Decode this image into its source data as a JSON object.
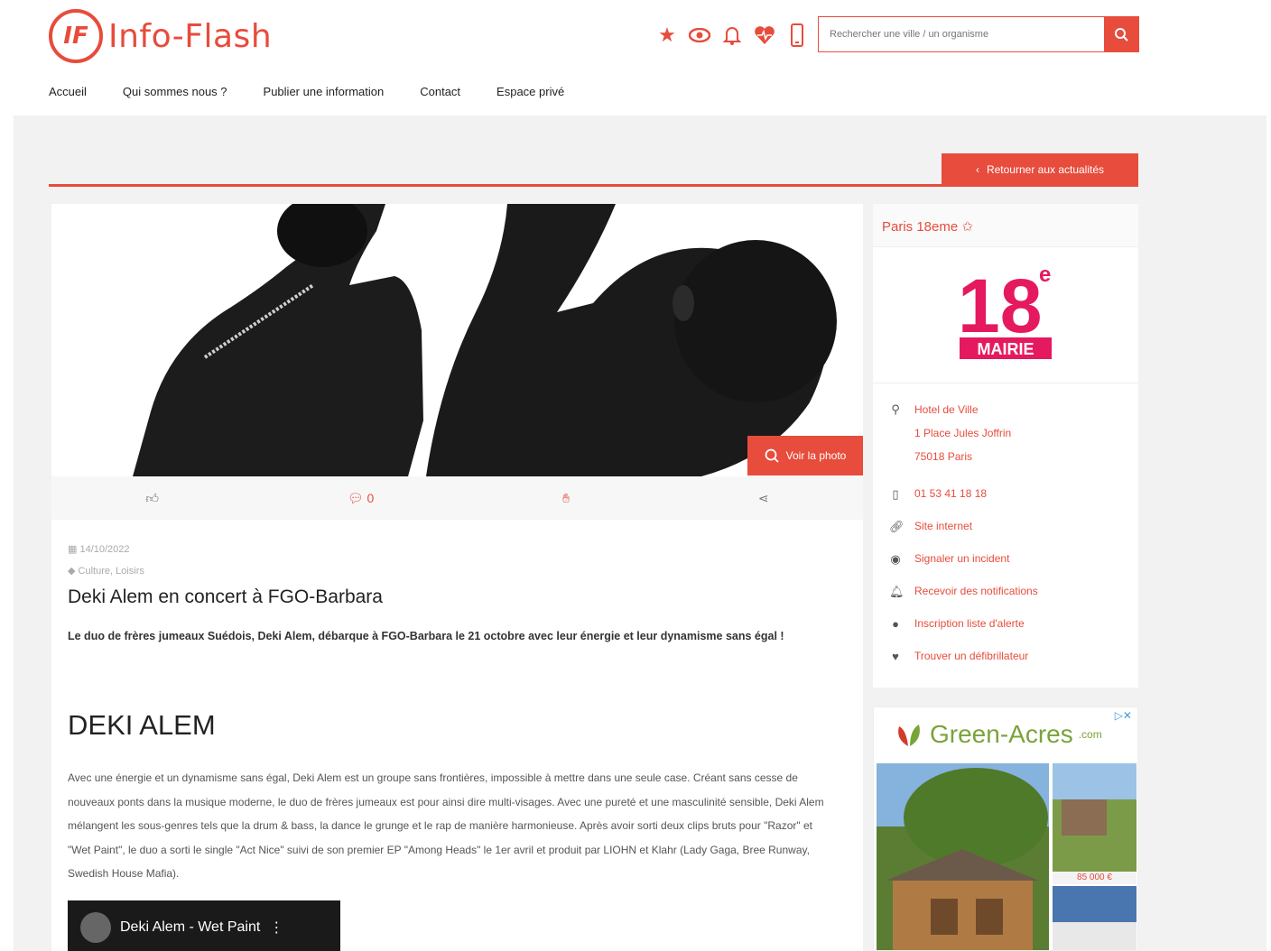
{
  "header": {
    "logo_mark": "IF",
    "logo_text": "Info-Flash",
    "search_placeholder": "Rechercher une ville / un organisme",
    "icons": [
      "star-icon",
      "eye-icon",
      "bell-icon",
      "heart-icon",
      "phone-icon"
    ]
  },
  "nav": {
    "items": [
      "Accueil",
      "Qui sommes nous ?",
      "Publier une information",
      "Contact",
      "Espace privé"
    ]
  },
  "back_button": "Retourner aux actualités",
  "article": {
    "view_photo": "Voir la photo",
    "comments_count": "0",
    "date": "14/10/2022",
    "category": "Culture, Loisirs",
    "title": "Deki Alem en concert à FGO-Barbara",
    "lead": "Le duo de frères jumeaux Suédois, Deki Alem, débarque à FGO-Barbara le 21 octobre avec leur énergie et leur dynamisme sans égal !",
    "h2": "DEKI ALEM",
    "body": "Avec une énergie et un dynamisme sans égal, Deki Alem est un groupe sans frontières, impossible à mettre dans une seule case. Créant sans cesse de nouveaux ponts dans la musique moderne, le duo de frères jumeaux est pour ainsi dire multi-visages. Avec une pureté et une masculinité sensible, Deki Alem mélangent les sous-genres tels que la drum & bass, la dance le grunge et le rap de manière harmonieuse. Après avoir sorti deux clips bruts pour \"Razor\" et \"Wet Paint\", le duo a sorti le single \"Act Nice\" suivi de son premier EP \"Among Heads\" le 1er avril et produit par LIOHN et Klahr (Lady Gaga, Bree Runway, Swedish House Mafia).",
    "video_title": "Deki Alem - Wet Paint"
  },
  "sidebar": {
    "title": "Paris 18eme ✩",
    "logo_number": "18",
    "logo_sup": "e",
    "logo_label": "MAIRIE",
    "address": [
      "Hotel de Ville",
      "1 Place Jules Joffrin",
      "75018 Paris"
    ],
    "phone": "01 53 41 18 18",
    "links": [
      "Site internet",
      "Signaler un incident",
      "Recevoir des notifications",
      "Inscription liste d'alerte",
      "Trouver un défibrillateur"
    ]
  },
  "ad": {
    "brand": "Green-Acres",
    "brand_suffix": ".com",
    "price": "85 000 €"
  },
  "colors": {
    "accent": "#e74c3c",
    "mairie": "#e5195f",
    "ad_green": "#7aa33a"
  }
}
